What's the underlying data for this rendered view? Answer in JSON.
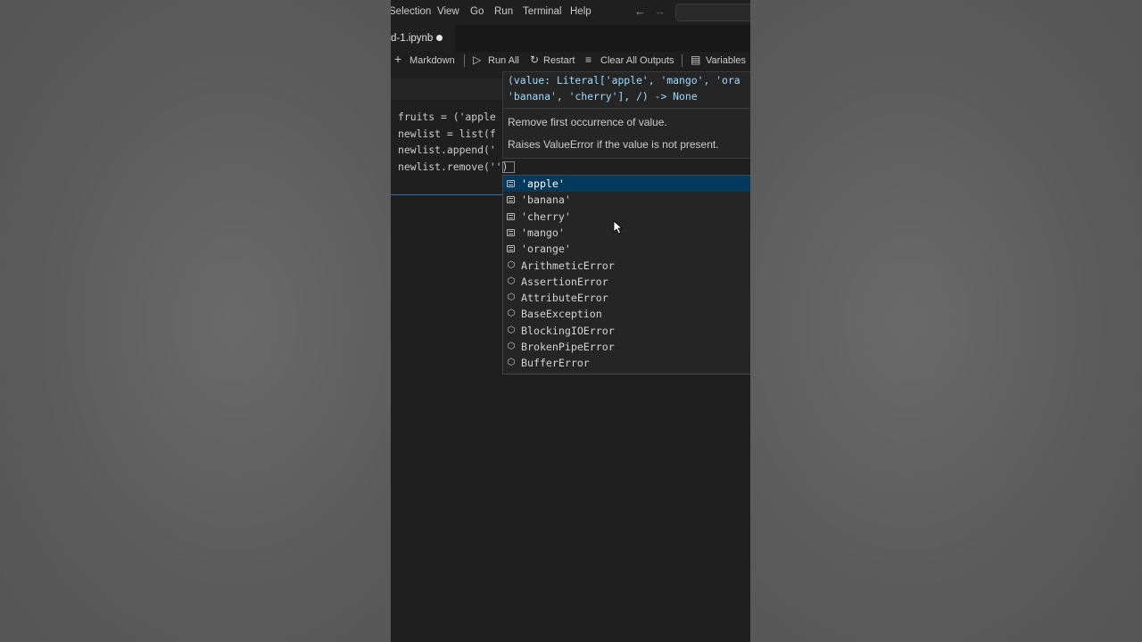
{
  "menubar": {
    "items": [
      "Selection",
      "View",
      "Go",
      "Run",
      "Terminal",
      "Help"
    ],
    "back_icon": "arrow-left-icon",
    "forward_icon": "arrow-right-icon"
  },
  "tab": {
    "label": "d-1.ipynb",
    "dirty": true
  },
  "toolbar": {
    "markdown": "Markdown",
    "run_all": "Run All",
    "restart": "Restart",
    "clear_outputs": "Clear All Outputs",
    "variables": "Variables"
  },
  "cell": {
    "lines": [
      "fruits = ('apple",
      "newlist = list(f",
      "newlist.append('",
      "newlist.remove('')"
    ]
  },
  "hover": {
    "signature_line1": "(value: Literal['apple', 'mango', 'ora",
    "signature_line2": "'banana', 'cherry'], /) -> None",
    "doc_line1": "Remove first occurrence of value.",
    "doc_line2": "Raises ValueError if the value is not present."
  },
  "suggestions": [
    {
      "label": "'apple'",
      "kind": "text",
      "selected": true
    },
    {
      "label": "'banana'",
      "kind": "text"
    },
    {
      "label": "'cherry'",
      "kind": "text"
    },
    {
      "label": "'mango'",
      "kind": "text"
    },
    {
      "label": "'orange'",
      "kind": "text"
    },
    {
      "label": "ArithmeticError",
      "kind": "class"
    },
    {
      "label": "AssertionError",
      "kind": "class"
    },
    {
      "label": "AttributeError",
      "kind": "class"
    },
    {
      "label": "BaseException",
      "kind": "class"
    },
    {
      "label": "BlockingIOError",
      "kind": "class"
    },
    {
      "label": "BrokenPipeError",
      "kind": "class"
    },
    {
      "label": "BufferError",
      "kind": "class"
    }
  ],
  "colors": {
    "editor_bg": "#1e1e1e",
    "selection": "#04395e",
    "keyword_blue": "#9cdcfe"
  }
}
